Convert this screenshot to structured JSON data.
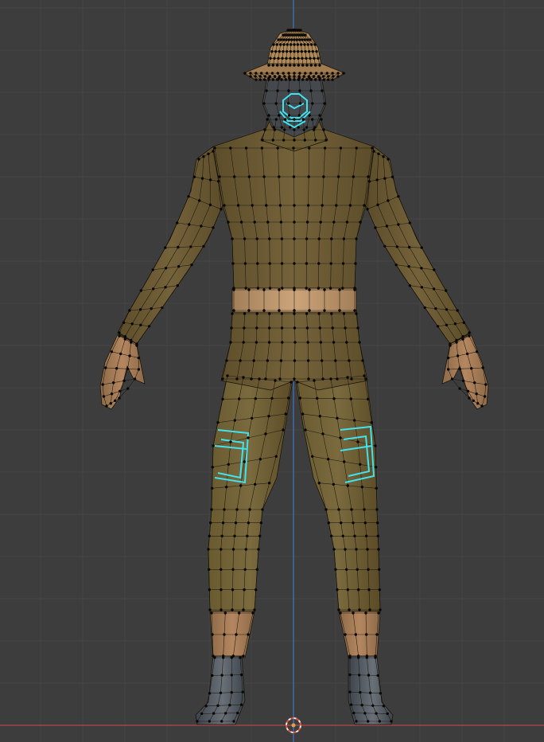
{
  "viewport": {
    "mode": "edit-mode-front-orthographic",
    "background_color": "#3d3d3d",
    "grid_minor_color": "#444444",
    "grid_major_color": "#505050",
    "axis_z_color": "#3f74c9",
    "axis_x_color": "#b0474f",
    "origin_cursor_colors": [
      "#e8e8e8",
      "#e2533a"
    ]
  },
  "model": {
    "name": "soldier-character",
    "uniform_color": "#6e5d34",
    "uniform_shadow_color": "#4a3e22",
    "skin_color": "#b48760",
    "belt_color": "#b59169",
    "hat_color": "#b18a5a",
    "boot_color": "#4e545c",
    "mask_color": "#45494e",
    "selected_edge_color": "#3fe3f0",
    "wire_color": "#1a160c",
    "vertex_color": "#0a0806"
  },
  "selection": {
    "selected_regions": [
      "mask-filter",
      "left-thigh-pocket",
      "right-thigh-pocket"
    ]
  }
}
